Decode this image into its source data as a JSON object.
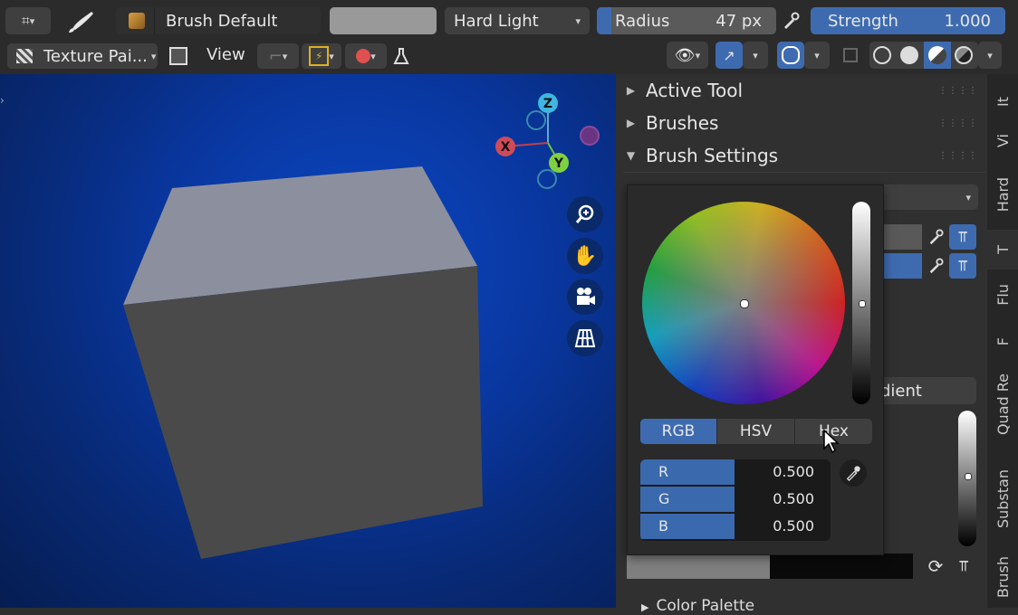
{
  "header": {
    "brush_name": "Brush Default",
    "blend_mode": "Hard Light",
    "radius": {
      "label": "Radius",
      "value": "47 px"
    },
    "strength": {
      "label": "Strength",
      "value": "1.000"
    },
    "mode": "Texture Pai...",
    "view_menu": "View"
  },
  "viewport": {
    "gizmo": {
      "z": "Z",
      "x": "X",
      "y": "Y"
    }
  },
  "panel": {
    "sections": [
      {
        "label": "Active Tool",
        "expanded": false
      },
      {
        "label": "Brushes",
        "expanded": false
      },
      {
        "label": "Brush Settings",
        "expanded": true
      }
    ],
    "peek_text": "dient",
    "color_palette": "Color Palette"
  },
  "color_picker": {
    "modes": [
      "RGB",
      "HSV",
      "Hex"
    ],
    "active_mode": "RGB",
    "channels": [
      {
        "label": "R",
        "value": "0.500"
      },
      {
        "label": "G",
        "value": "0.500"
      },
      {
        "label": "B",
        "value": "0.500"
      }
    ]
  },
  "tabs": [
    "It",
    "Vi",
    "Hard",
    "T",
    "Flu",
    "F",
    "Quad Re",
    "Substan",
    "Brush"
  ],
  "colors": {
    "accent": "#3e6bb0",
    "viewport": "#0a3aa8",
    "panel": "#303030"
  }
}
